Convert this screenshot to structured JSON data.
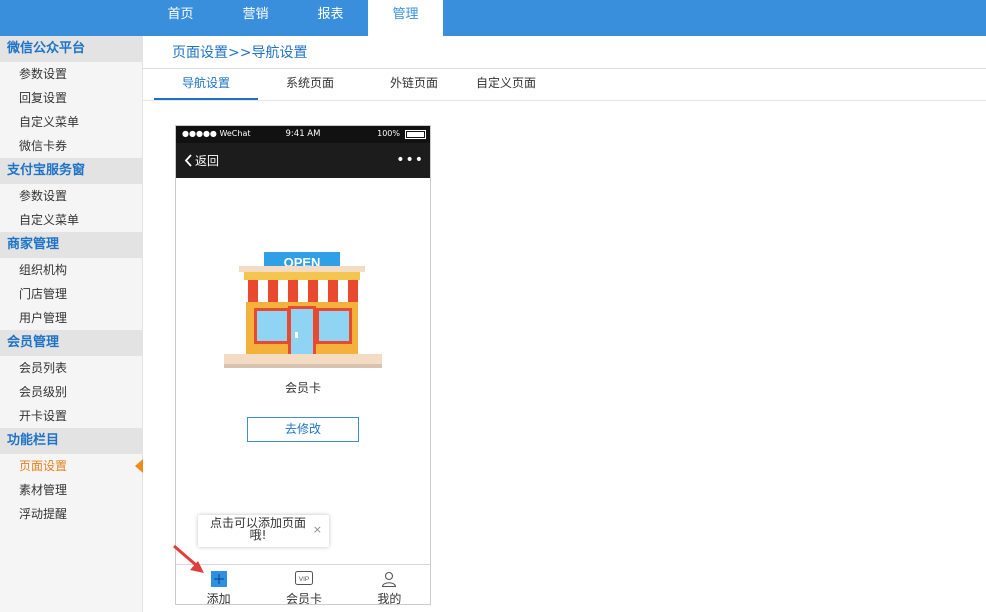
{
  "top_nav": {
    "tabs": [
      {
        "label": "首页",
        "active": false
      },
      {
        "label": "营销",
        "active": false
      },
      {
        "label": "报表",
        "active": false
      },
      {
        "label": "管理",
        "active": true
      }
    ]
  },
  "sidebar": {
    "groups": [
      {
        "title": "微信公众平台",
        "items": [
          "参数设置",
          "回复设置",
          "自定义菜单",
          "微信卡券"
        ]
      },
      {
        "title": "支付宝服务窗",
        "items": [
          "参数设置",
          "自定义菜单"
        ]
      },
      {
        "title": "商家管理",
        "items": [
          "组织机构",
          "门店管理",
          "用户管理"
        ]
      },
      {
        "title": "会员管理",
        "items": [
          "会员列表",
          "会员级别",
          "开卡设置"
        ]
      },
      {
        "title": "功能栏目",
        "items": [
          "页面设置",
          "素材管理",
          "浮动提醒"
        ]
      }
    ],
    "active_item": "页面设置"
  },
  "breadcrumb": "页面设置>>导航设置",
  "subtabs": [
    {
      "label": "导航设置",
      "active": true
    },
    {
      "label": "系统页面",
      "active": false
    },
    {
      "label": "外链页面",
      "active": false
    },
    {
      "label": "自定义页面",
      "active": false
    }
  ],
  "phone": {
    "status": {
      "carrier": "●●●●● WeChat",
      "time": "9:41 AM",
      "battery": "100%"
    },
    "header": {
      "back_label": "返回",
      "more": "•••"
    },
    "store_sign": "OPEN",
    "store_label": "会员卡",
    "edit_button": "去修改",
    "tooltip": {
      "text": "点击可以添加页面哦!",
      "close": "×"
    },
    "tabbar": [
      {
        "label": "添加",
        "icon": "add-icon"
      },
      {
        "label": "会员卡",
        "icon": "vip-card-icon"
      },
      {
        "label": "我的",
        "icon": "user-icon"
      }
    ]
  },
  "colors": {
    "accent": "#3a8fdd",
    "active_orange": "#e7801e",
    "sidebar_bg": "#f5f5f5",
    "group_bg": "#e3e3e3"
  }
}
